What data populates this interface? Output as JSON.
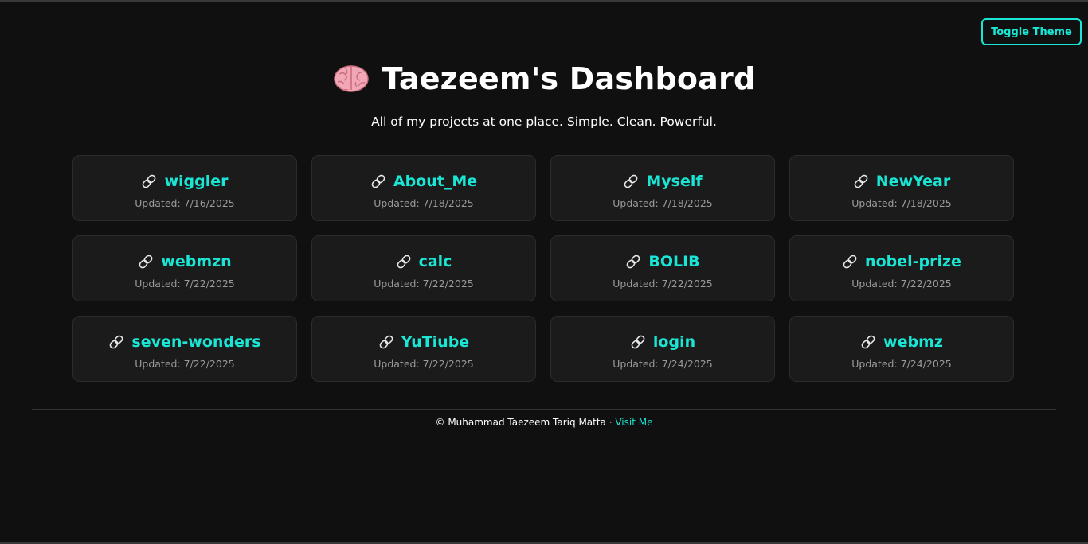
{
  "header": {
    "toggle_label": "Toggle Theme",
    "title": "Taezeem's Dashboard",
    "subtitle": "All of my projects at one place. Simple. Clean. Powerful."
  },
  "projects": [
    {
      "name": "wiggler",
      "updated": "Updated: 7/16/2025"
    },
    {
      "name": "About_Me",
      "updated": "Updated: 7/18/2025"
    },
    {
      "name": "Myself",
      "updated": "Updated: 7/18/2025"
    },
    {
      "name": "NewYear",
      "updated": "Updated: 7/18/2025"
    },
    {
      "name": "webmzn",
      "updated": "Updated: 7/22/2025"
    },
    {
      "name": "calc",
      "updated": "Updated: 7/22/2025"
    },
    {
      "name": "BOLIB",
      "updated": "Updated: 7/22/2025"
    },
    {
      "name": "nobel-prize",
      "updated": "Updated: 7/22/2025"
    },
    {
      "name": "seven-wonders",
      "updated": "Updated: 7/22/2025"
    },
    {
      "name": "YuTiube",
      "updated": "Updated: 7/22/2025"
    },
    {
      "name": "login",
      "updated": "Updated: 7/24/2025"
    },
    {
      "name": "webmz",
      "updated": "Updated: 7/24/2025"
    }
  ],
  "footer": {
    "copyright": "© Muhammad Taezeem Tariq Matta · ",
    "link_label": "Visit Me"
  },
  "colors": {
    "background": "#101010",
    "card": "#1b1b1b",
    "accent": "#19e6d4",
    "muted": "#9a9a9a"
  },
  "icons": {
    "title": "brain-icon",
    "card": "link-icon"
  }
}
